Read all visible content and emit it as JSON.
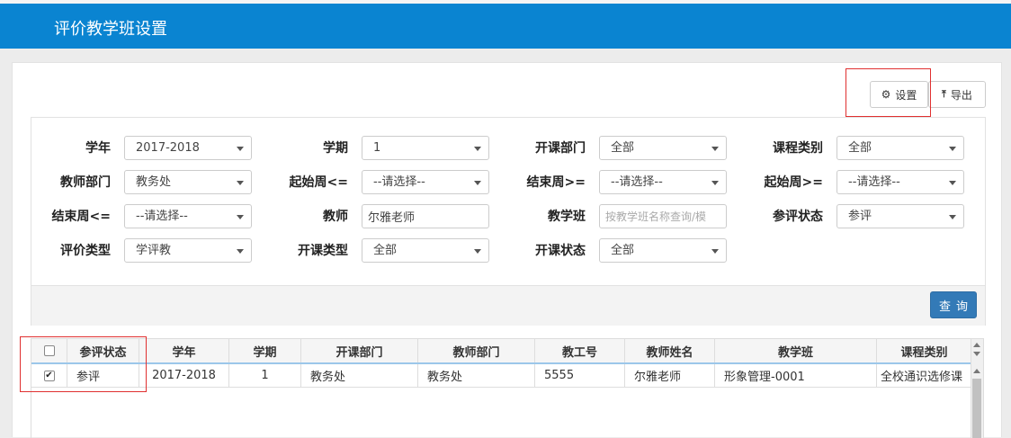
{
  "header": {
    "title": "评价教学班设置"
  },
  "toolbar": {
    "settings_label": "设置",
    "export_label": "导出"
  },
  "filters": {
    "xuenian": {
      "label": "学年",
      "value": "2017-2018"
    },
    "xueqi": {
      "label": "学期",
      "value": "1"
    },
    "kaikebumen": {
      "label": "开课部门",
      "value": "全部"
    },
    "kechengleibie": {
      "label": "课程类别",
      "value": "全部"
    },
    "jiaoshibumen": {
      "label": "教师部门",
      "value": "教务处"
    },
    "qishizhou_le": {
      "label": "起始周<=",
      "value": "--请选择--"
    },
    "jieshuzhou_ge": {
      "label": "结束周>=",
      "value": "--请选择--"
    },
    "qishizhou_ge": {
      "label": "起始周>=",
      "value": "--请选择--"
    },
    "jieshuzhou_le": {
      "label": "结束周<=",
      "value": "--请选择--"
    },
    "jiaoshi": {
      "label": "教师",
      "value": "尔雅老师"
    },
    "jiaoxueban": {
      "label": "教学班",
      "value": "",
      "placeholder": "按教学班名称查询/模"
    },
    "canpingzhuangtai": {
      "label": "参评状态",
      "value": "参评"
    },
    "pingjialeixing": {
      "label": "评价类型",
      "value": "学评教"
    },
    "kaikeleixing": {
      "label": "开课类型",
      "value": "全部"
    },
    "kaikezhuangtai": {
      "label": "开课状态",
      "value": "全部"
    },
    "query_label": "查询"
  },
  "grid": {
    "columns": [
      "参评状态",
      "学年",
      "学期",
      "开课部门",
      "教师部门",
      "教工号",
      "教师姓名",
      "教学班",
      "课程类别"
    ],
    "rows": [
      {
        "checked": true,
        "cells": [
          "参评",
          "2017-2018",
          "1",
          "教务处",
          "教务处",
          "5555",
          "尔雅老师",
          "形象管理-0001",
          "全校通识选修课"
        ]
      }
    ]
  }
}
